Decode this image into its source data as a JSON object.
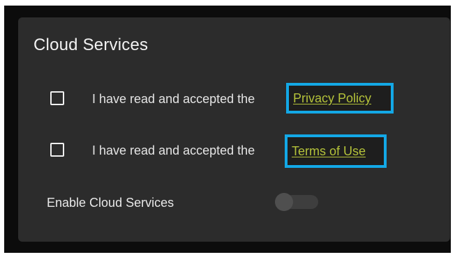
{
  "card": {
    "title": "Cloud Services"
  },
  "agreements": [
    {
      "text": "I have read and accepted the",
      "link_label": "Privacy Policy",
      "checked": false
    },
    {
      "text": "I have read and accepted the",
      "link_label": "Terms of Use",
      "checked": false
    }
  ],
  "enable": {
    "label": "Enable Cloud Services",
    "toggle_on": false
  },
  "colors": {
    "card_background": "#2c2c2c",
    "frame_background": "#0c0c0c",
    "link": "#b4c23a",
    "highlight_border": "#13a8e6"
  }
}
